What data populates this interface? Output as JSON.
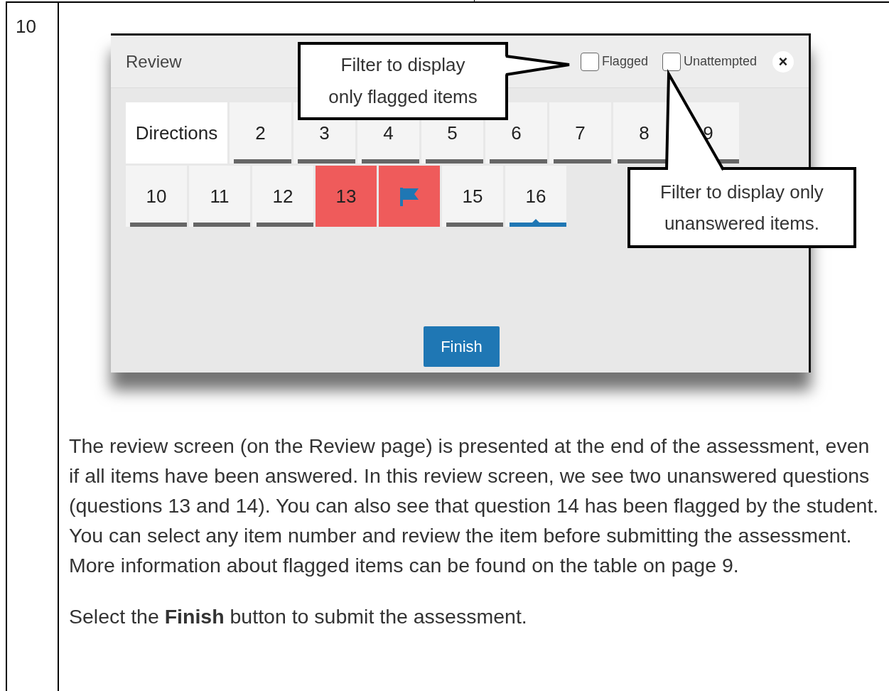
{
  "row_number": "10",
  "review": {
    "title": "Review",
    "filters": [
      {
        "label": "Flagged",
        "checked": false
      },
      {
        "label": "Unattempted",
        "checked": false
      }
    ],
    "close": "×",
    "tile_rows": [
      [
        {
          "kind": "directions",
          "label": "Directions"
        },
        {
          "kind": "question",
          "label": "2",
          "answered": true,
          "flagged": false,
          "selected": false
        },
        {
          "kind": "question",
          "label": "3",
          "answered": true,
          "flagged": false,
          "selected": false
        },
        {
          "kind": "question",
          "label": "4",
          "answered": true,
          "flagged": false,
          "selected": false
        },
        {
          "kind": "question",
          "label": "5",
          "answered": true,
          "flagged": false,
          "selected": false
        },
        {
          "kind": "question",
          "label": "6",
          "answered": true,
          "flagged": false,
          "selected": false
        },
        {
          "kind": "question",
          "label": "7",
          "answered": true,
          "flagged": false,
          "selected": false
        },
        {
          "kind": "question",
          "label": "8",
          "answered": true,
          "flagged": false,
          "selected": false
        },
        {
          "kind": "question",
          "label": "9",
          "answered": true,
          "flagged": false,
          "selected": false
        }
      ],
      [
        {
          "kind": "question",
          "label": "10",
          "answered": true,
          "flagged": false,
          "selected": false
        },
        {
          "kind": "question",
          "label": "11",
          "answered": true,
          "flagged": false,
          "selected": false
        },
        {
          "kind": "question",
          "label": "12",
          "answered": true,
          "flagged": false,
          "selected": false
        },
        {
          "kind": "question",
          "label": "13",
          "answered": false,
          "flagged": false,
          "selected": false
        },
        {
          "kind": "question",
          "answered": false,
          "flagged": true,
          "selected": false
        },
        {
          "kind": "question",
          "label": "15",
          "answered": true,
          "flagged": false,
          "selected": false
        },
        {
          "kind": "question",
          "label": "16",
          "answered": true,
          "flagged": false,
          "selected": true
        }
      ]
    ],
    "finish": "Finish"
  },
  "callouts": [
    {
      "text": "Filter to display only flagged items"
    },
    {
      "text": "Filter to display only unanswered items."
    }
  ],
  "paragraphs": [
    "The review screen (on the Review page) is presented at the end of the assessment, even if all items have been answered. In this review screen, we see two unanswered questions (questions 13 and 14). You can also see that question 14 has been flagged by the student. You can select any item number and review the item before submitting the assessment.  More information about flagged items can be found on the table on page 9.",
    "Select the **Finish** button to submit the assessment."
  ]
}
